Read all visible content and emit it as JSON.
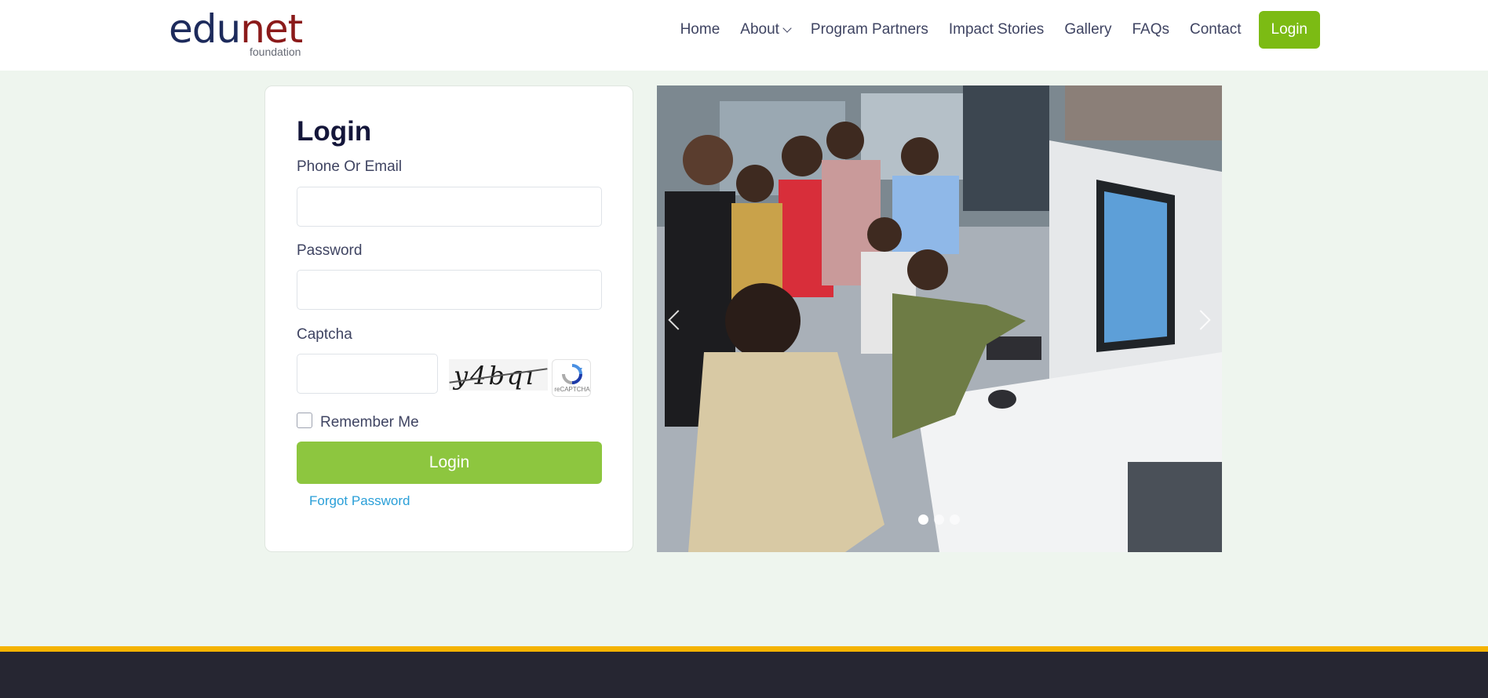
{
  "brand": {
    "logo_word_part1": "edu",
    "logo_word_part2": "net",
    "logo_sub": "foundation",
    "primary_color": "#1d2b5c",
    "accent_color": "#8b1a1a"
  },
  "nav": {
    "items": [
      {
        "label": "Home"
      },
      {
        "label": "About",
        "icon": "chevron-down-icon"
      },
      {
        "label": "Program Partners"
      },
      {
        "label": "Impact Stories"
      },
      {
        "label": "Gallery"
      },
      {
        "label": "FAQs"
      },
      {
        "label": "Contact"
      }
    ],
    "login_label": "Login",
    "login_color": "#7cbb14"
  },
  "login_form": {
    "title": "Login",
    "phone_label": "Phone Or Email",
    "phone_value": "",
    "password_label": "Password",
    "password_value": "",
    "captcha_label": "Captcha",
    "captcha_value": "",
    "captcha_text": "y4bqı",
    "recaptcha_label": "reCAPTCHA",
    "remember_label": "Remember Me",
    "remember_checked": false,
    "submit_label": "Login",
    "submit_color": "#8dc63f",
    "forgot_label": "Forgot Password",
    "link_color": "#2a9fd8"
  },
  "carousel": {
    "slide_count": 3,
    "active_index": 0,
    "prev_icon": "chevron-left-icon",
    "next_icon": "chevron-right-icon",
    "image_subject": "students gathered around an IoT and telematics workbench in a lab"
  },
  "footer": {
    "stripe_color": "#f5b301",
    "background_color": "#262632"
  }
}
